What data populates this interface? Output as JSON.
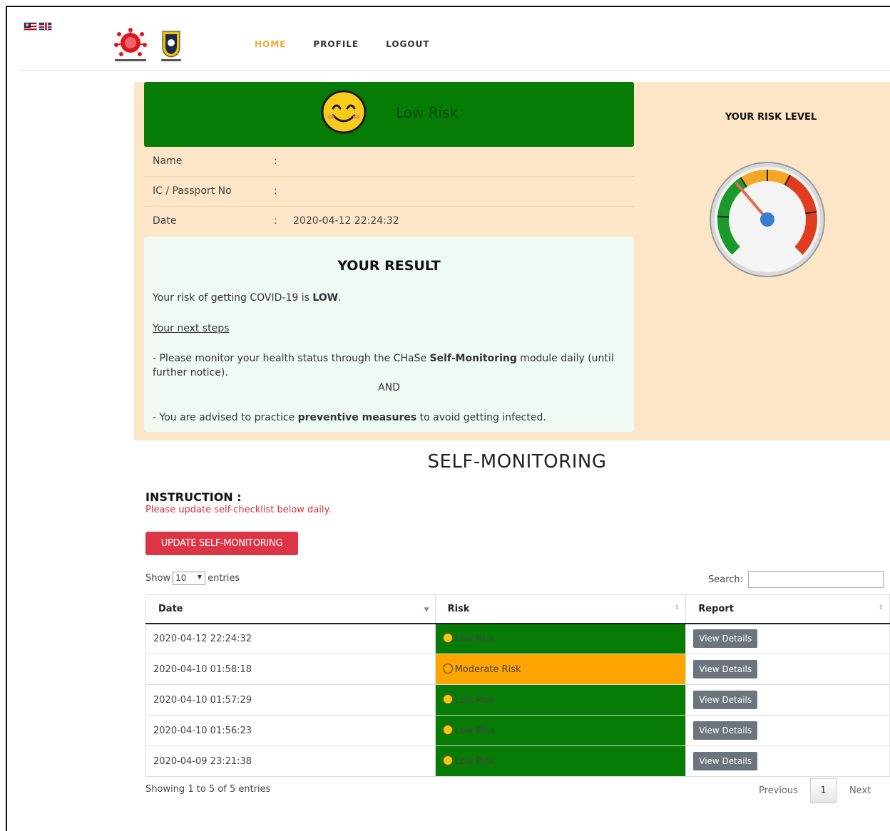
{
  "header": {
    "flags": [
      "malaysia-flag",
      "uk-flag"
    ],
    "logos": [
      "chase-covid19-logo",
      "unisza-logo"
    ],
    "nav": [
      {
        "label": "HOME",
        "active": true
      },
      {
        "label": "PROFILE",
        "active": false
      },
      {
        "label": "LOGOUT",
        "active": false
      }
    ]
  },
  "risk_banner": {
    "label": "Low Risk",
    "icon": "smiley-face-icon",
    "color": "#067c06"
  },
  "details": [
    {
      "label": "Name",
      "colon": ":",
      "value": ""
    },
    {
      "label": "IC / Passport No",
      "colon": ":",
      "value": ""
    },
    {
      "label": "Date",
      "colon": ":",
      "value": "2020-04-12 22:24:32"
    }
  ],
  "result": {
    "title": "YOUR RESULT",
    "line1_prefix": "Your risk of getting COVID-19 is ",
    "line1_bold": "LOW",
    "line1_suffix": ".",
    "next_steps": "Your next steps",
    "step1_prefix": "- Please monitor your health status through the CHaSe ",
    "step1_bold": "Self-Monitoring",
    "step1_suffix": " module daily (until further notice).",
    "and": "AND",
    "step2_prefix": "- You are advised to practice ",
    "step2_bold": "preventive measures",
    "step2_suffix": " to avoid getting infected."
  },
  "gauge": {
    "title": "YOUR RISK LEVEL",
    "level": 0.35,
    "colors": {
      "low": "#1a9a2a",
      "moderate": "#f5a623",
      "high": "#e03c1f",
      "needle": "#e66a4a",
      "hub": "#3a7bd5"
    }
  },
  "self_monitoring": {
    "title": "SELF-MONITORING",
    "instruction_title": "INSTRUCTION :",
    "instruction_text": "Please update self-checklist below daily.",
    "update_button": "UPDATE SELF-MONITORING",
    "show_label": "Show",
    "entries_value": "10",
    "entries_label": "entries",
    "search_label": "Search:",
    "search_value": "",
    "columns": [
      "Date",
      "Risk",
      "Report"
    ],
    "rows": [
      {
        "date": "2020-04-12 22:24:32",
        "risk": "Low Risk",
        "risk_level": "low",
        "face": "☺",
        "report": "View Details"
      },
      {
        "date": "2020-04-10 01:58:18",
        "risk": "Moderate Risk",
        "risk_level": "moderate",
        "face": "😐",
        "report": "View Details"
      },
      {
        "date": "2020-04-10 01:57:29",
        "risk": "Low Risk",
        "risk_level": "low",
        "face": "☺",
        "report": "View Details"
      },
      {
        "date": "2020-04-10 01:56:23",
        "risk": "Low Risk",
        "risk_level": "low",
        "face": "☺",
        "report": "View Details"
      },
      {
        "date": "2020-04-09 23:21:38",
        "risk": "Low Risk",
        "risk_level": "low",
        "face": "☺",
        "report": "View Details"
      }
    ],
    "showing_text": "Showing 1 to 5 of 5 entries",
    "pagination": {
      "previous": "Previous",
      "current": "1",
      "next": "Next"
    }
  }
}
